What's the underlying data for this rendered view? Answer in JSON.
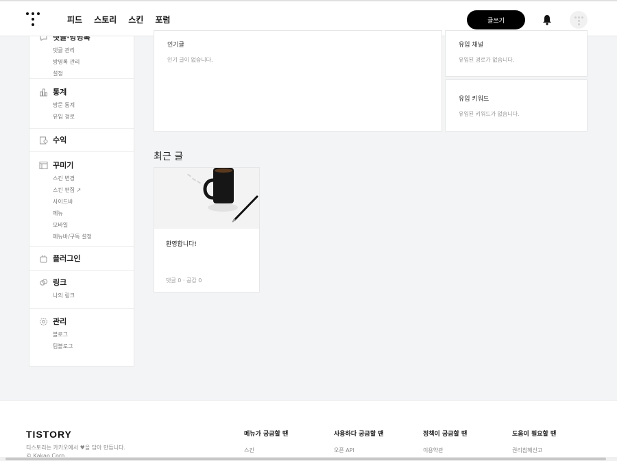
{
  "header": {
    "nav": [
      "피드",
      "스토리",
      "스킨",
      "포럼"
    ],
    "write_label": "글쓰기"
  },
  "sidebar": {
    "top": {
      "label": "댓글·방명록",
      "items": [
        "댓글 관리",
        "방명록 관리",
        "설정"
      ]
    },
    "stats": {
      "label": "통계",
      "items": [
        "방문 통계",
        "유입 경로"
      ]
    },
    "revenue": {
      "label": "수익"
    },
    "design": {
      "label": "꾸미기",
      "items": [
        "스킨 변경",
        "스킨 편집 ↗",
        "사이드바",
        "메뉴",
        "모바일",
        "메뉴바/구독 설정"
      ]
    },
    "plugin": {
      "label": "플러그인"
    },
    "link": {
      "label": "링크",
      "items": [
        "나의 링크"
      ]
    },
    "manage": {
      "label": "관리",
      "items": [
        "블로그",
        "팀블로그"
      ]
    }
  },
  "cards": {
    "popular": {
      "title": "인기글",
      "empty": "인기 글이 없습니다."
    },
    "channel": {
      "title": "유입 채널",
      "empty": "유입된 경로가 없습니다."
    },
    "keyword": {
      "title": "유입 키워드",
      "empty": "유입된 키워드가 없습니다."
    }
  },
  "recent": {
    "title": "최근 글",
    "post": {
      "title": "환영합니다!",
      "meta": "댓글 0 · 공감 0"
    }
  },
  "footer": {
    "logo": "TISTORY",
    "desc": "티스토리는 카카오에서 ♥을 담아 만듭니다.",
    "copy": "© Kakao Corp.",
    "columns": [
      {
        "heading": "메뉴가 궁금할 땐",
        "link": "스킨"
      },
      {
        "heading": "사용하다 궁금할 땐",
        "link": "오픈 API"
      },
      {
        "heading": "정책이 궁금할 땐",
        "link": "이용약관"
      },
      {
        "heading": "도움이 필요할 땐",
        "link": "권리침해신고"
      }
    ]
  }
}
